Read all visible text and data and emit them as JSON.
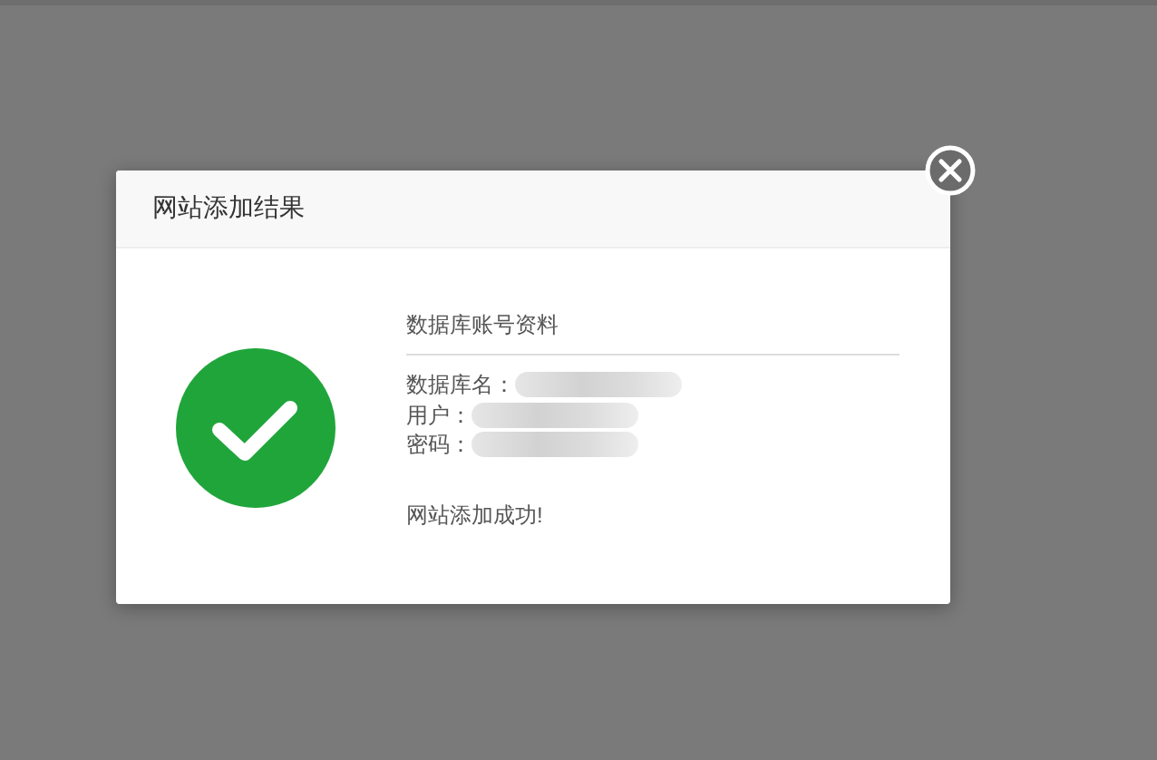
{
  "dialog": {
    "title": "网站添加结果",
    "success": true,
    "section_title": "数据库账号资料",
    "fields": [
      {
        "label": "数据库名：",
        "redacted": true
      },
      {
        "label": "用户：",
        "redacted": true
      },
      {
        "label": "密码：",
        "redacted": true
      }
    ],
    "message": "网站添加成功!"
  }
}
